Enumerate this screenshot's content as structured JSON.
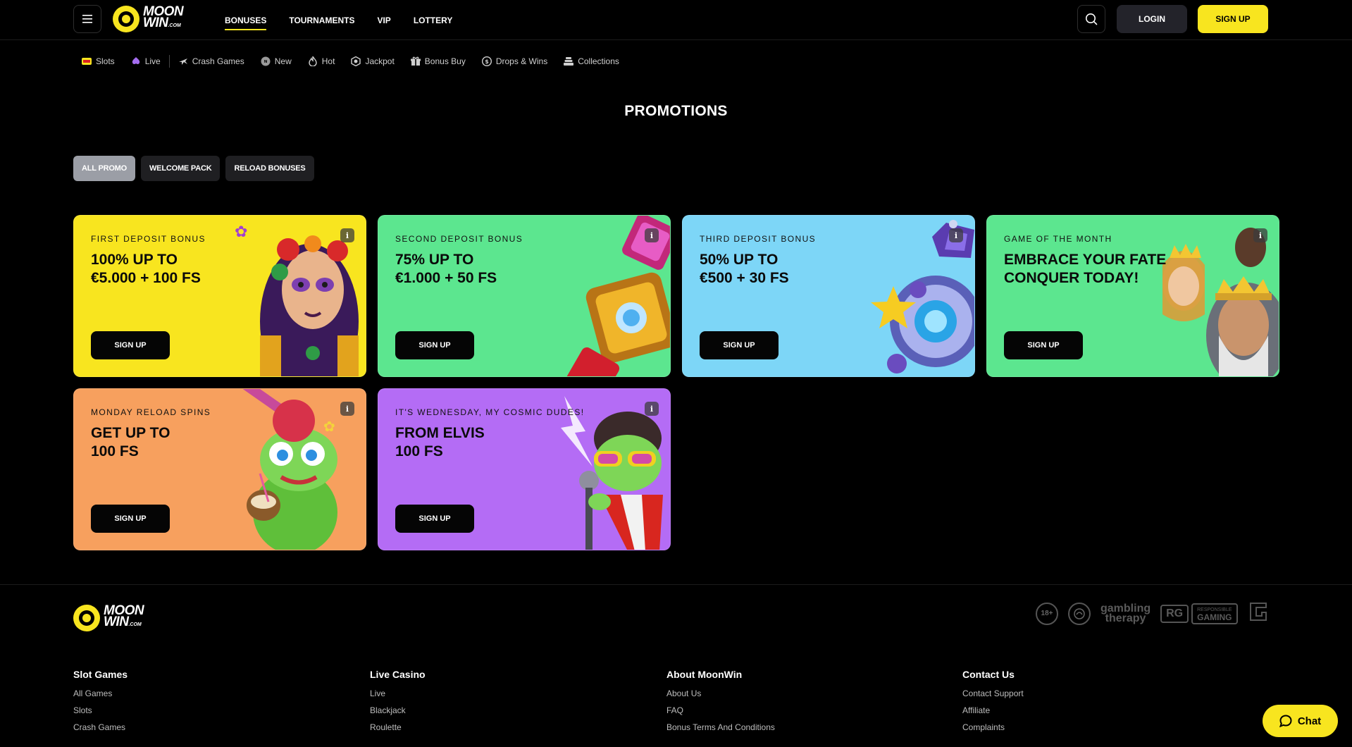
{
  "colors": {
    "brand_yellow": "#f8e51f",
    "background": "#000000",
    "card_yellow": "#f8e51f",
    "card_green": "#5ce68f",
    "card_blue": "#7dd6f7",
    "card_orange": "#f7a05e",
    "card_purple": "#b46cf5"
  },
  "brand": {
    "name_line1": "MOON",
    "name_line2": "WIN",
    "suffix": ".COM"
  },
  "header": {
    "nav": [
      "BONUSES",
      "TOURNAMENTS",
      "VIP",
      "LOTTERY"
    ],
    "login_label": "LOGIN",
    "signup_label": "SIGN UP"
  },
  "categories": [
    {
      "label": "Slots",
      "icon": "slot-machine-icon"
    },
    {
      "label": "Live",
      "icon": "live-icon"
    },
    {
      "label": "Crash Games",
      "icon": "plane-icon"
    },
    {
      "label": "New",
      "icon": "new-icon"
    },
    {
      "label": "Hot",
      "icon": "flame-icon"
    },
    {
      "label": "Jackpot",
      "icon": "jackpot-icon"
    },
    {
      "label": "Bonus Buy",
      "icon": "gift-icon"
    },
    {
      "label": "Drops & Wins",
      "icon": "coin-icon"
    },
    {
      "label": "Collections",
      "icon": "stack-icon"
    }
  ],
  "page_title": "PROMOTIONS",
  "filters": [
    "ALL PROMO",
    "WELCOME PACK",
    "RELOAD BONUSES"
  ],
  "promos": [
    {
      "eyebrow": "FIRST DEPOSIT BONUS",
      "title1": "100% UP TO",
      "title2": "€5.000 + 100 FS",
      "button": "SIGN UP",
      "info": "i"
    },
    {
      "eyebrow": "SECOND DEPOSIT BONUS",
      "title1": "75% UP TO",
      "title2": "€1.000 + 50 FS",
      "button": "SIGN UP",
      "info": "i"
    },
    {
      "eyebrow": "THIRD DEPOSIT BONUS",
      "title1": "50% UP TO",
      "title2": "€500 + 30 FS",
      "button": "SIGN UP",
      "info": "i"
    },
    {
      "eyebrow": "GAME OF THE MONTH",
      "title1": "EMBRACE YOUR FATE",
      "title2": "CONQUER TODAY!",
      "button": "SIGN UP",
      "info": "i"
    },
    {
      "eyebrow": "MONDAY RELOAD SPINS",
      "title1": "GET UP TO",
      "title2": "100 FS",
      "button": "SIGN UP",
      "info": "i"
    },
    {
      "eyebrow": "IT'S WEDNESDAY, MY COSMIC DUDES!",
      "title1": "FROM ELVIS",
      "title2": "100 FS",
      "button": "SIGN UP",
      "info": "i"
    }
  ],
  "footer": {
    "badges": {
      "age": "18+",
      "therapy_line1": "gambling",
      "therapy_line2": "therapy",
      "rg_mark": "RG",
      "rg_line1": "RESPONSIBLE",
      "rg_line2": "GAMING"
    },
    "columns": [
      {
        "title": "Slot Games",
        "links": [
          "All Games",
          "Slots",
          "Crash Games"
        ]
      },
      {
        "title": "Live Casino",
        "links": [
          "Live",
          "Blackjack",
          "Roulette"
        ]
      },
      {
        "title": "About MoonWin",
        "links": [
          "About Us",
          "FAQ",
          "Bonus Terms And Conditions"
        ]
      },
      {
        "title": "Contact Us",
        "links": [
          "Contact Support",
          "Affiliate",
          "Complaints"
        ]
      }
    ]
  },
  "chat_label": "Chat"
}
